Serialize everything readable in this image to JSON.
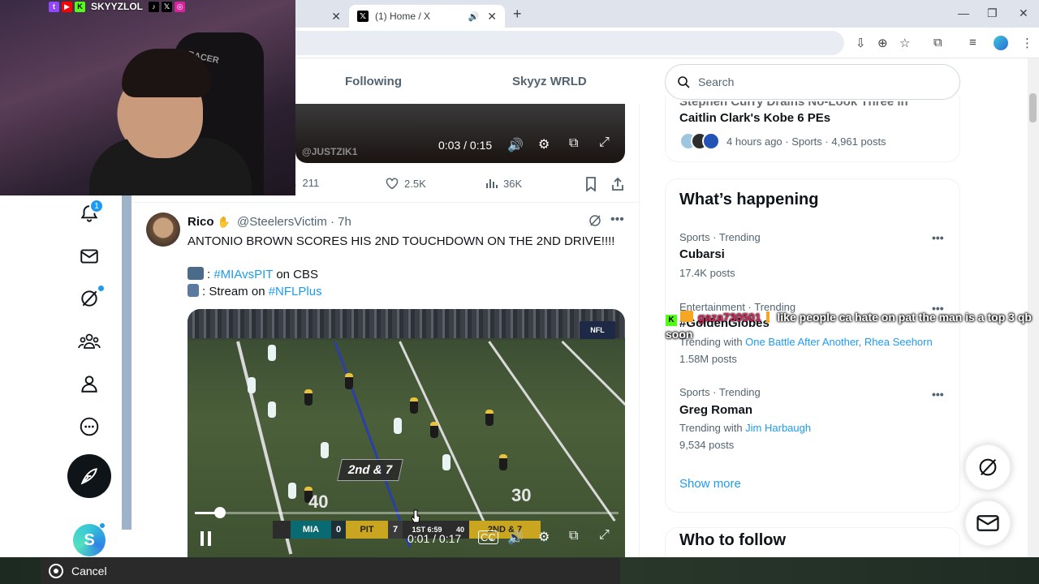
{
  "browser": {
    "tabs": [
      {
        "title": ""
      },
      {
        "title": "(1) Home / X"
      }
    ],
    "new_tab": "+",
    "tab_close": "✕"
  },
  "stream_overlay": {
    "channel_name": "SKYYZLOL",
    "chat": {
      "username": "gaza730501",
      "message": "like people ca hate on pat the man is a top 3 qb soon"
    }
  },
  "nav": {
    "notification_count": "1",
    "avatar_letter": "S"
  },
  "timeline": {
    "tabs": [
      "Following",
      "Skyyz WRLD"
    ],
    "prev_tweet": {
      "video_watermark": "@JUSTZIK1",
      "video_time": "0:03 / 0:15",
      "replies": "211",
      "likes": "2.5K",
      "views": "36K"
    },
    "tweet": {
      "name": "Rico",
      "handle_time": "@SteelersVictim · 7h",
      "text": "ANTONIO BROWN SCORES HIS 2ND TOUCHDOWN ON THE 2ND DRIVE!!!!",
      "line2_sep": ": ",
      "line2_link": "#MIAvsPIT",
      "line2_rest": " on CBS",
      "line3_prefix": ": Stream on ",
      "line3_link": "#NFLPlus",
      "video": {
        "down_distance": "2nd & 7",
        "yard_left": "40",
        "yard_right": "30",
        "corner_logo": "NFL",
        "team_away": "MIA",
        "score_away": "0",
        "team_home": "PIT",
        "score_home": "7",
        "quarter_clock": "1ST  6:59",
        "play_clock": "40",
        "down_tag": "2ND & 7",
        "time": "0:01 / 0:17",
        "progress_fraction": 0.06
      }
    }
  },
  "right": {
    "search_placeholder": "Search",
    "top_story": {
      "title_partial": "Stephen Curry Drains No-Look Three in",
      "title": "Caitlin Clark's Kobe 6 PEs",
      "meta": "4 hours ago · Sports · 4,961 posts"
    },
    "happening_title": "What’s happening",
    "trends": [
      {
        "meta": "Sports · Trending",
        "name": "Cubarsi",
        "with_prefix": "",
        "with_links": "",
        "posts": "17.4K posts"
      },
      {
        "meta": "Entertainment · Trending",
        "name": "#GoldenGlobes",
        "with_prefix": "Trending with ",
        "with_links": "One Battle After Another, Rhea Seehorn",
        "posts": "1.58M posts"
      },
      {
        "meta": "Sports · Trending",
        "name": "Greg Roman",
        "with_prefix": "Trending with ",
        "with_links": "Jim Harbaugh",
        "posts": "9,534 posts"
      }
    ],
    "show_more": "Show more",
    "who_to_follow": "Who to follow"
  },
  "bottom": {
    "cancel_label": "Cancel"
  },
  "colors": {
    "accent": "#1d9bf0",
    "text_primary": "#0f1419",
    "text_secondary": "#536471"
  }
}
